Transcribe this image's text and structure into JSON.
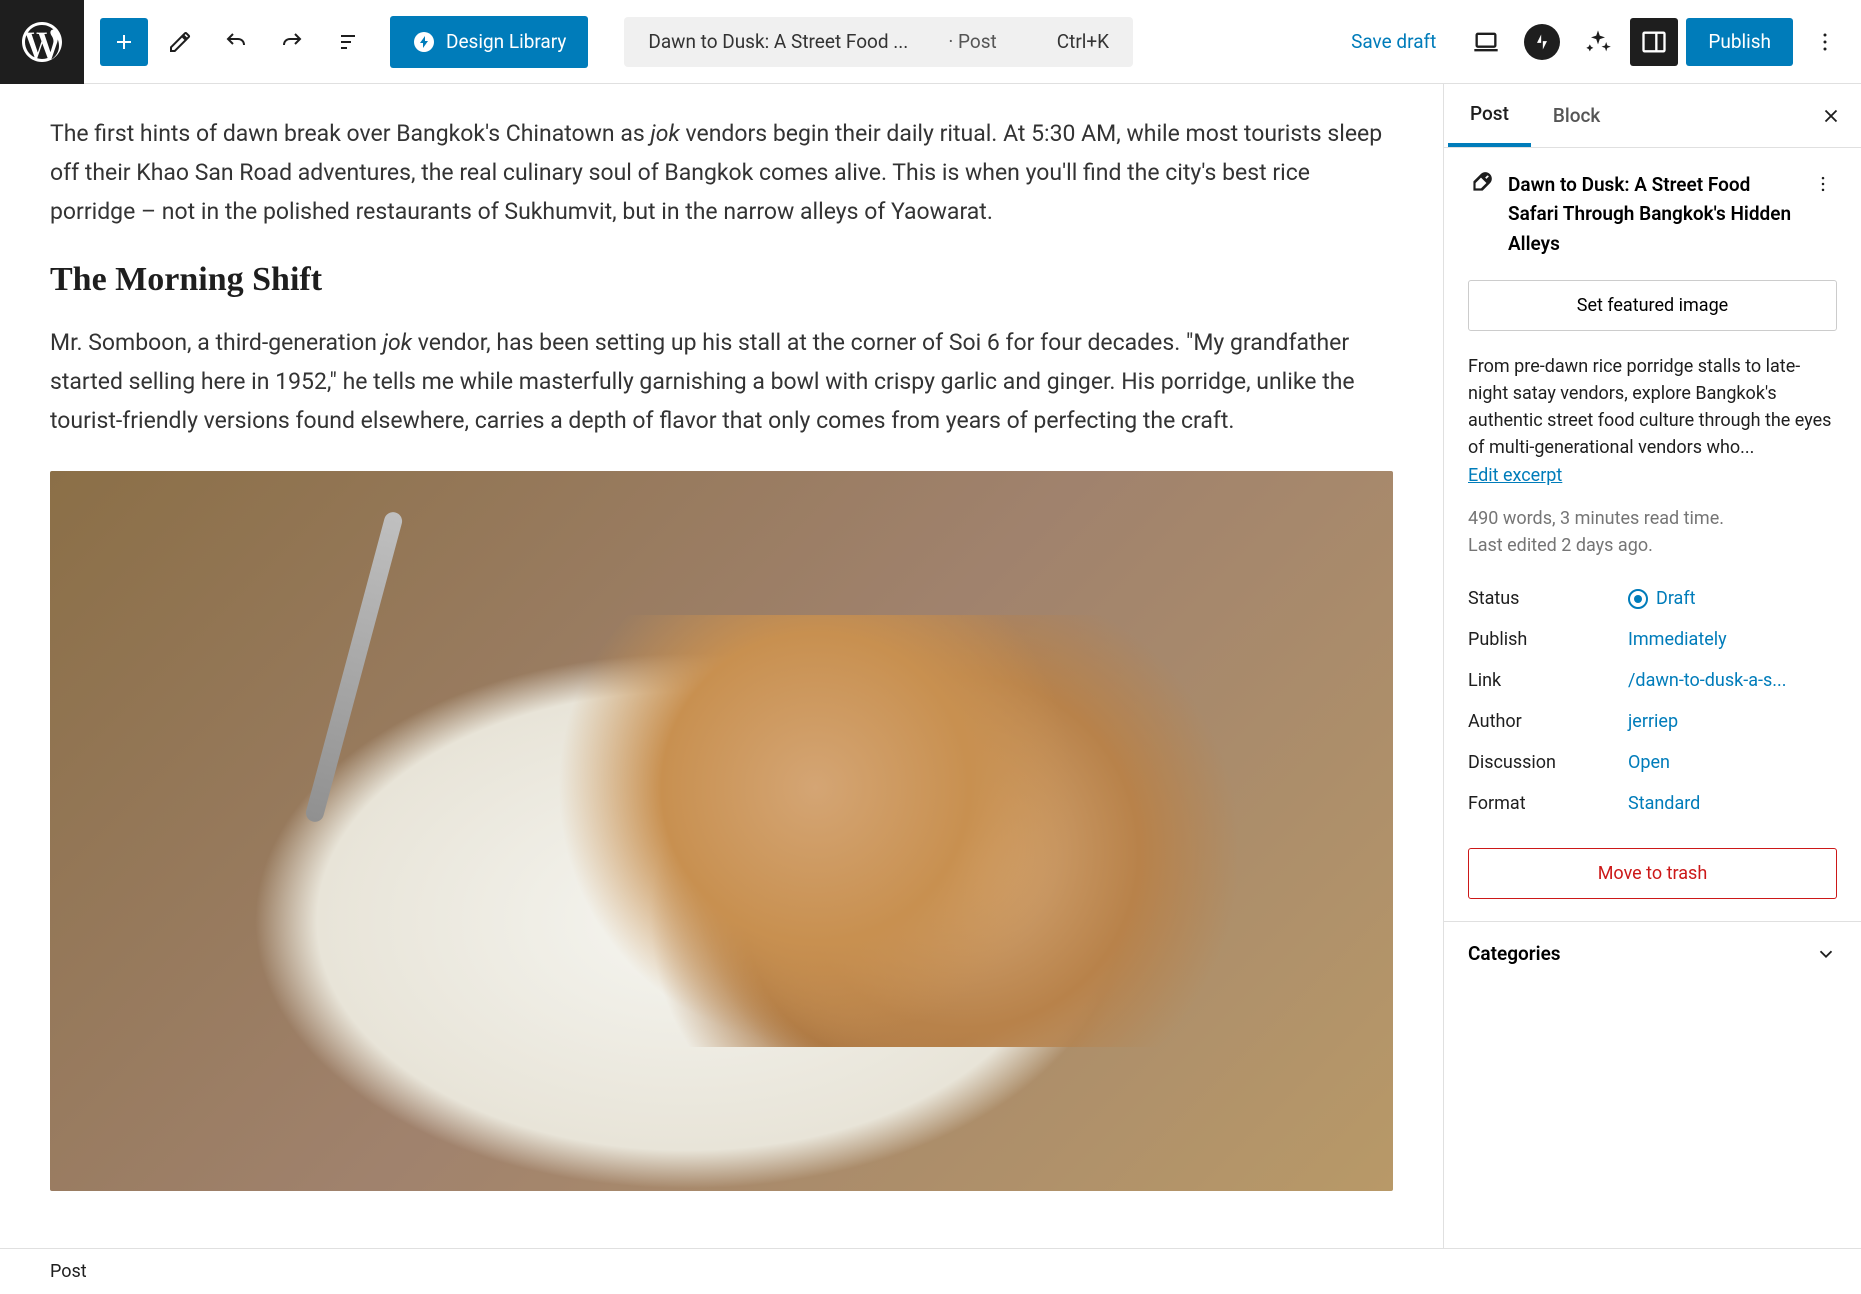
{
  "toolbar": {
    "design_library_label": "Design Library",
    "command_title": "Dawn to Dusk: A Street Food ...",
    "command_type": "Post",
    "command_shortcut": "Ctrl+K",
    "save_draft_label": "Save draft",
    "publish_label": "Publish"
  },
  "content": {
    "para1_prefix": "The first hints of dawn break over Bangkok's Chinatown as ",
    "para1_italic": "jok",
    "para1_suffix": " vendors begin their daily ritual. At 5:30 AM, while most tourists sleep off their Khao San Road adventures, the real culinary soul of Bangkok comes alive. This is when you'll find the city's best rice porridge – not in the polished restaurants of Sukhumvit, but in the narrow alleys of Yaowarat.",
    "heading1": "The Morning Shift",
    "para2_prefix": "Mr. Somboon, a third-generation ",
    "para2_italic": "jok",
    "para2_suffix": " vendor, has been setting up his stall at the corner of Soi 6 for four decades. \"My grandfather started selling here in 1952,\" he tells me while masterfully garnishing a bowl with crispy garlic and ginger. His porridge, unlike the tourist-friendly versions found elsewhere, carries a depth of flavor that only comes from years of perfecting the craft."
  },
  "sidebar": {
    "tabs": {
      "post": "Post",
      "block": "Block"
    },
    "post_title": "Dawn to Dusk: A Street Food Safari Through Bangkok's Hidden Alleys",
    "featured_image_label": "Set featured image",
    "excerpt_preview": "From pre-dawn rice porridge stalls to late-night satay vendors, explore Bangkok's authentic street food culture through the eyes of multi-generational vendors who...",
    "edit_excerpt_label": "Edit excerpt",
    "word_count_text": "490 words, 3 minutes read time.",
    "last_edited_text": "Last edited 2 days ago.",
    "summary": {
      "status_label": "Status",
      "status_value": "Draft",
      "publish_label": "Publish",
      "publish_value": "Immediately",
      "link_label": "Link",
      "link_value": "/dawn-to-dusk-a-s...",
      "author_label": "Author",
      "author_value": "jerriep",
      "discussion_label": "Discussion",
      "discussion_value": "Open",
      "format_label": "Format",
      "format_value": "Standard"
    },
    "trash_label": "Move to trash",
    "categories_label": "Categories"
  },
  "breadcrumb": {
    "item1": "Post"
  }
}
